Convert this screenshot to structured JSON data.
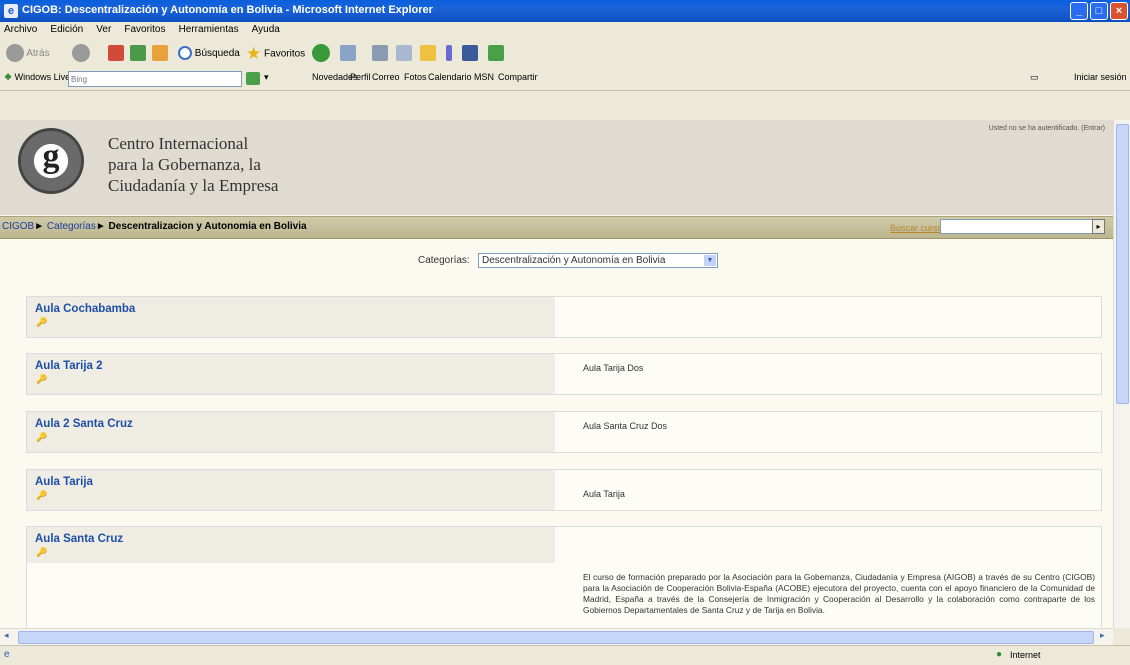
{
  "window": {
    "title": "CIGOB: Descentralización y Autonomía en Bolivia - Microsoft Internet Explorer",
    "minimize": "_",
    "maximize": "□",
    "close": "×"
  },
  "menubar": [
    "Archivo",
    "Edición",
    "Ver",
    "Favoritos",
    "Herramientas",
    "Ayuda"
  ],
  "toolbar": {
    "back_label": "Atrás",
    "search_label": "Búsqueda",
    "favorites_label": "Favoritos"
  },
  "linksbar": {
    "windows_live": "Windows Live",
    "search_placeholder": "Bing",
    "links": [
      "Novedades",
      "Perfil",
      "Correo",
      "Fotos",
      "Calendario",
      "MSN",
      "Compartir"
    ],
    "sign_in": "Iniciar sesión"
  },
  "header": {
    "site_name_line1": "Centro Internacional",
    "site_name_line2": "para la Gobernanza, la",
    "site_name_line3": "Ciudadanía y la Empresa",
    "logo_letter": "g",
    "login_info": "Usted no se ha autentificado. (Entrar)"
  },
  "navbar": {
    "crumb_home": "CIGOB",
    "crumb_categories": "Categorías",
    "crumb_current": "Descentralizacion y Autonomia en Bolivia",
    "sep": "►",
    "search_label": "Buscar cursos:"
  },
  "category": {
    "label": "Categorías:",
    "selected": "Descentralización y Autonomía en Bolivia"
  },
  "courses": [
    {
      "name": "Aula Cochabamba",
      "key": "🔑",
      "summary": ""
    },
    {
      "name": "Aula Tarija 2",
      "key": "🔑",
      "summary": "Aula Tarija Dos"
    },
    {
      "name": "Aula 2 Santa Cruz",
      "key": "🔑",
      "summary": "Aula Santa Cruz Dos"
    },
    {
      "name": "Aula Tarija",
      "key": "🔑",
      "summary": "Aula Tarija"
    },
    {
      "name": "Aula Santa Cruz",
      "key": "🔑",
      "summary": "El curso de formación preparado por la Asociación para la Gobernanza, Ciudadanía y Empresa (AIGOB) a través de su Centro (CIGOB) para la Asociación de Cooperación Bolivia-España (ACOBE) ejecutora del proyecto, cuenta con el apoyo financiero de la Comunidad de Madrid, España a través de la Consejería de Inmigración y Cooperación al Desarrollo y la colaboración como contraparte de los Gobiernos Departamentales de Santa Cruz y de Tarija en Bolivia."
    }
  ],
  "status": {
    "zone": "Internet"
  }
}
